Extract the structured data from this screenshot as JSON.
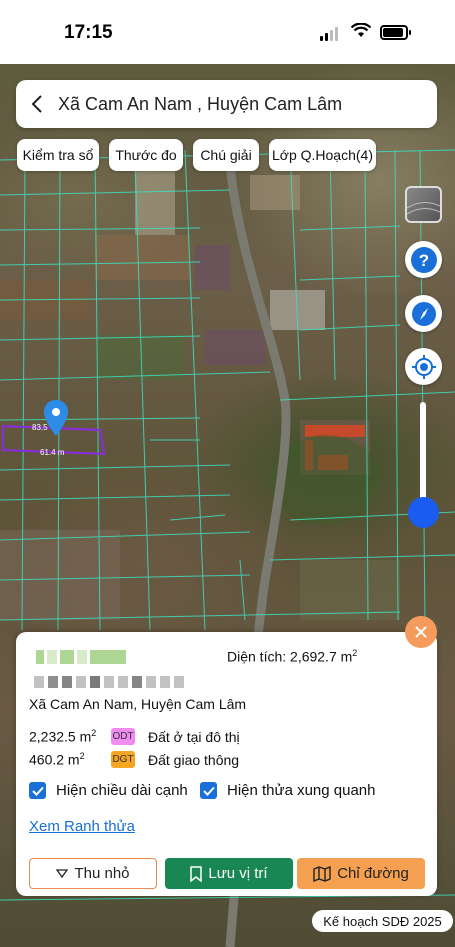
{
  "status_bar": {
    "time": "17:15"
  },
  "header": {
    "title": "Xã Cam An Nam , Huyện Cam Lâm"
  },
  "chips": [
    {
      "label": "Kiểm tra sổ"
    },
    {
      "label": "Thước đo"
    },
    {
      "label": "Chú giải"
    },
    {
      "label": "Lớp Q.Hoạch(4)"
    }
  ],
  "map": {
    "parcel_labels": [
      "83.5",
      "61.4 m"
    ],
    "plan_label": "Kế hoạch SDĐ 2025"
  },
  "panel": {
    "area_label": "Diện tích: 2,692.7 m",
    "area_sup": "2",
    "address": "Xã Cam An Nam, Huyện Cam Lâm",
    "land_uses": [
      {
        "value": "2,232.5 m",
        "code": "ODT",
        "name": "Đất ở tại đô thị",
        "color": "#f08cf0"
      },
      {
        "value": "460.2 m",
        "code": "DGT",
        "name": "Đất giao thông",
        "color": "#f5a623"
      }
    ],
    "checkbox_edge_length": "Hiện chiều dài cạnh",
    "checkbox_neighbors": "Hiện thửa xung quanh",
    "view_boundary_link": "Xem Ranh thửa",
    "btn_collapse": "Thu nhỏ",
    "btn_save": "Lưu vị trí",
    "btn_directions": "Chỉ đường"
  },
  "colors": {
    "parcel_line": "#3de0c0",
    "selected_parcel": "#8a2be2",
    "accent_blue": "#1a6fd8",
    "save_green": "#198754",
    "directions_orange": "#f5a050"
  }
}
